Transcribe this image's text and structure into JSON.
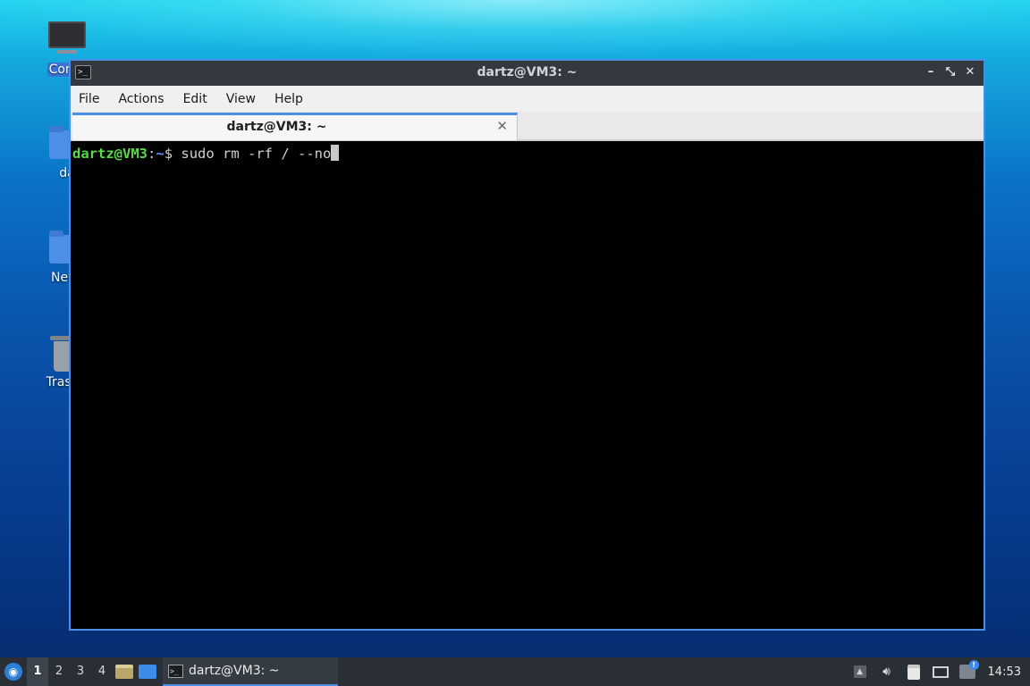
{
  "desktop": {
    "icons": [
      {
        "label": "Comp",
        "icon": "computer-icon"
      },
      {
        "label": "da",
        "icon": "home-folder-icon"
      },
      {
        "label": "Netw",
        "icon": "network-folder-icon"
      },
      {
        "label": "Trash (",
        "icon": "trash-icon"
      }
    ]
  },
  "window": {
    "title": "dartz@VM3: ~",
    "app_icon": ">_",
    "controls": [
      "–",
      "⤡",
      "✕"
    ],
    "menu": [
      "File",
      "Actions",
      "Edit",
      "View",
      "Help"
    ],
    "tab": {
      "title": "dartz@VM3: ~",
      "close": "✕"
    },
    "terminal": {
      "user_host": "dartz@VM3",
      "sep": ":",
      "path": "~",
      "prompt_symbol": "$ ",
      "command": "sudo rm -rf / --no"
    }
  },
  "taskbar": {
    "start_icon": "lubuntu-logo-icon",
    "desktops": [
      "1",
      "2",
      "3",
      "4"
    ],
    "active_desktop": "1",
    "launchers": [
      "file-manager-icon",
      "show-desktop-icon"
    ],
    "task": {
      "label": "dartz@VM3: ~",
      "icon": ">_"
    },
    "tray": [
      "tray-expand-icon",
      "volume-icon",
      "clipboard-icon",
      "network-icon",
      "update-notifier-icon"
    ],
    "clock": "14:53"
  },
  "colors": {
    "accent": "#4a8ee6",
    "prompt_user": "#5ad94a",
    "prompt_path": "#6b8cff",
    "terminal_bg": "#000000"
  }
}
